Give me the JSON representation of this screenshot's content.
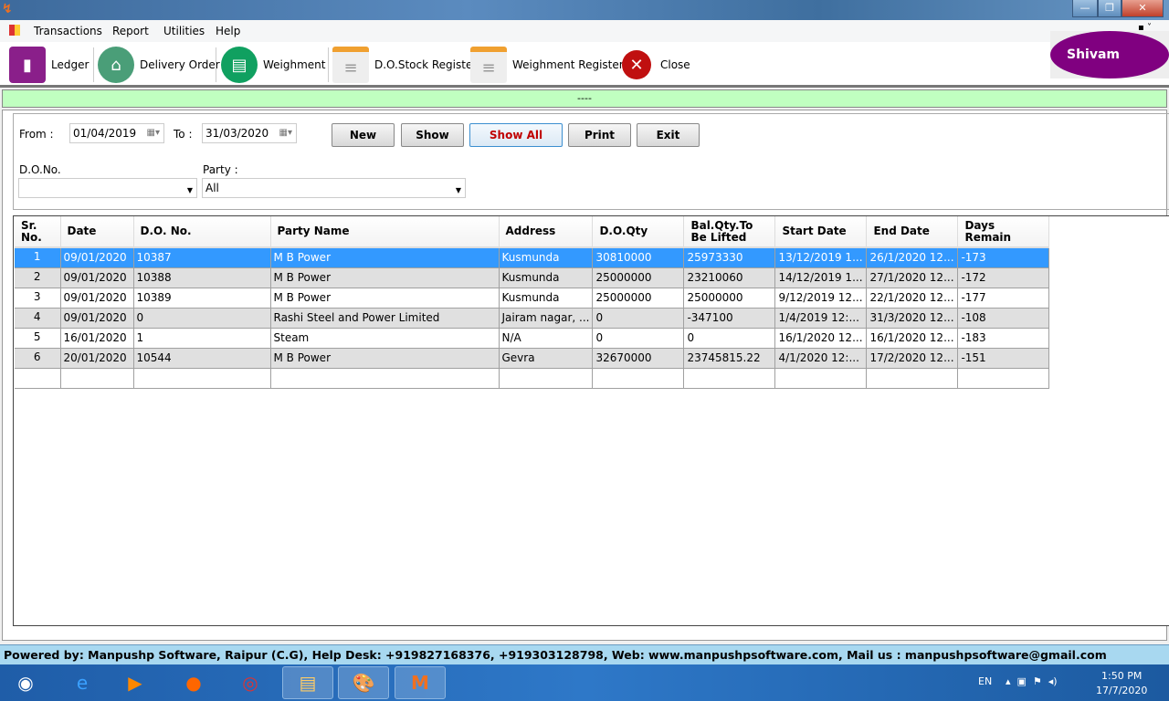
{
  "window": {
    "app_icon": "mp-logo-icon",
    "controls": [
      "minimize",
      "restore",
      "close"
    ]
  },
  "menu": [
    "Transactions",
    "Report",
    "Utilities",
    "Help"
  ],
  "toolbar": [
    {
      "label": "Ledger",
      "icon": "ledger-book-icon"
    },
    {
      "label": "Delivery Order",
      "icon": "basket-icon"
    },
    {
      "label": "Weighment",
      "icon": "weighment-icon"
    },
    {
      "label": "D.O.Stock Register",
      "icon": "register-doc-icon"
    },
    {
      "label": "Weighment Register",
      "icon": "register-doc-icon"
    },
    {
      "label": "Close",
      "icon": "close-icon"
    }
  ],
  "user": "Shivam",
  "status_text": "----",
  "filters": {
    "from_label": "From :",
    "from_value": "01/04/2019",
    "to_label": "To :",
    "to_value": "31/03/2020",
    "do_label": "D.O.No.",
    "do_value": "",
    "party_label": "Party :",
    "party_value": "All"
  },
  "buttons": {
    "new": "New",
    "show": "Show",
    "show_all": "Show All",
    "print": "Print",
    "exit": "Exit"
  },
  "grid": {
    "headers": [
      "Sr.\nNo.",
      "Date",
      "D.O. No.",
      "Party Name",
      "Address",
      "D.O.Qty",
      "Bal.Qty.To\nBe Lifted",
      "Start Date",
      "End Date",
      "Days\nRemain"
    ],
    "rows": [
      [
        "1",
        "09/01/2020",
        "10387",
        "M B Power",
        "Kusmunda",
        "30810000",
        "25973330",
        "13/12/2019 1...",
        "26/1/2020 12...",
        "-173"
      ],
      [
        "2",
        "09/01/2020",
        "10388",
        "M B Power",
        "Kusmunda",
        "25000000",
        "23210060",
        "14/12/2019 1...",
        "27/1/2020 12...",
        "-172"
      ],
      [
        "3",
        "09/01/2020",
        "10389",
        "M B Power",
        "Kusmunda",
        "25000000",
        "25000000",
        "9/12/2019 12...",
        "22/1/2020 12...",
        "-177"
      ],
      [
        "4",
        "09/01/2020",
        "0",
        "Rashi Steel and Power Limited",
        "Jairam nagar, ...",
        "0",
        "-347100",
        "1/4/2019 12:...",
        "31/3/2020 12...",
        "-108"
      ],
      [
        "5",
        "16/01/2020",
        "1",
        "Steam",
        "N/A",
        "0",
        "0",
        "16/1/2020 12...",
        "16/1/2020 12...",
        "-183"
      ],
      [
        "6",
        "20/01/2020",
        "10544",
        "M B Power",
        "Gevra",
        "32670000",
        "23745815.22",
        "4/1/2020 12:...",
        "17/2/2020 12...",
        "-151"
      ]
    ],
    "selected_row": 1
  },
  "footer": "Powered by: Manpushp Software, Raipur (C.G), Help Desk: +919827168376, +919303128798, Web: www.manpushpsoftware.com,  Mail us :  manpushpsoftware@gmail.com",
  "taskbar": {
    "apps": [
      "start-orb-icon",
      "internet-explorer-icon",
      "media-player-icon",
      "firefox-icon",
      "chrome-icon",
      "file-explorer-icon",
      "paint-icon",
      "manpushp-app-icon"
    ],
    "lang": "EN",
    "time": "1:50 PM",
    "date": "17/7/2020"
  },
  "colors": {
    "selection": "#3399ff",
    "status_bar": "#c0ffc0",
    "footer": "#a8d8f0",
    "user_badge": "#800080",
    "show_all_text": "#c00000"
  }
}
